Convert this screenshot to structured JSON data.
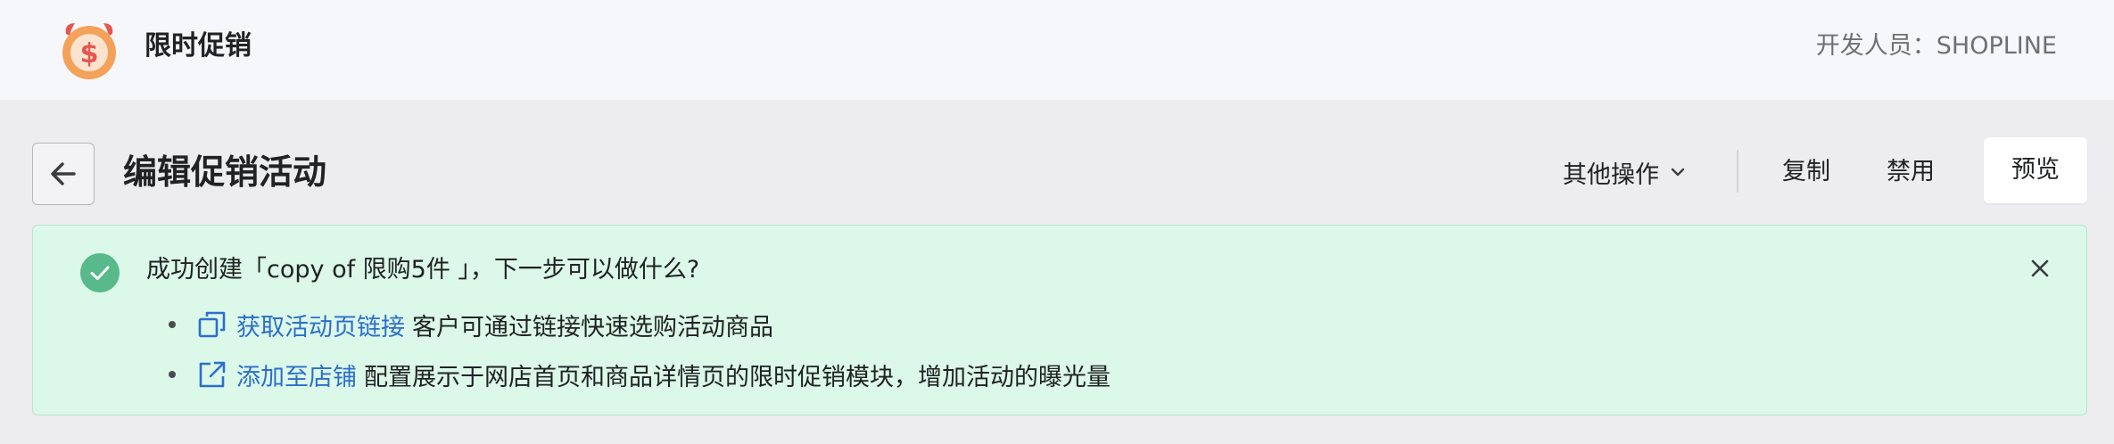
{
  "header": {
    "app_title": "限时促销",
    "developer_label": "开发人员：",
    "developer_name": "SHOPLINE",
    "logo_icon": "alarm-clock-dollar-icon"
  },
  "page": {
    "title": "编辑促销活动",
    "back_icon": "arrow-left-icon",
    "actions": {
      "more_label": "其他操作",
      "copy_label": "复制",
      "disable_label": "禁用",
      "preview_label": "预览"
    }
  },
  "banner": {
    "title": "成功创建「copy of 限购5件 」，下一步可以做什么?",
    "items": [
      {
        "icon": "copy-icon",
        "link": "获取活动页链接",
        "desc": "客户可通过链接快速选购活动商品"
      },
      {
        "icon": "external-link-icon",
        "link": "添加至店铺",
        "desc": "配置展示于网店首页和商品详情页的限时促销模块，增加活动的曝光量"
      }
    ]
  },
  "colors": {
    "header_bg": "#f6f7fb",
    "page_bg": "#ededf0",
    "banner_bg": "#dbf8e8",
    "banner_border": "#b7e7cd",
    "success_green": "#58b98b",
    "link_blue": "#2c6ecb",
    "logo_orange": "#f4a259",
    "logo_red": "#e4574f"
  }
}
